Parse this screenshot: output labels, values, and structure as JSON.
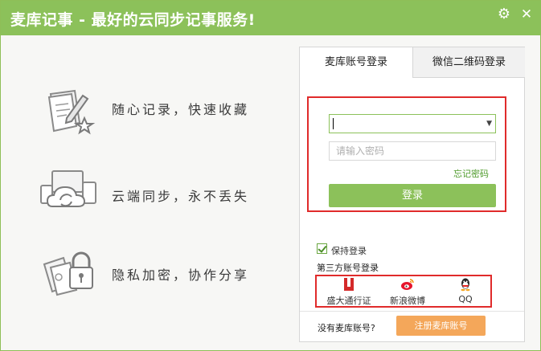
{
  "window": {
    "title": "麦库记事 - 最好的云同步记事服务!"
  },
  "features": [
    {
      "label": "随心记录，快速收藏",
      "icon": "note-pencil-star-icon"
    },
    {
      "label": "云端同步，永不丢失",
      "icon": "cloud-sync-devices-icon"
    },
    {
      "label": "隐私加密，协作分享",
      "icon": "padlock-documents-icon"
    }
  ],
  "tabs": {
    "account": "麦库账号登录",
    "qr": "微信二维码登录",
    "active": "account"
  },
  "login": {
    "account_value": "",
    "password_placeholder": "请输入密码",
    "forgot": "忘记密码",
    "button": "登录"
  },
  "remember": {
    "label": "保持登录",
    "checked": true
  },
  "third_party": {
    "label": "第三方账号登录",
    "providers": [
      {
        "label": "盛大通行证",
        "icon": "shanda-icon"
      },
      {
        "label": "新浪微博",
        "icon": "weibo-icon"
      },
      {
        "label": "QQ",
        "icon": "qq-penguin-icon"
      }
    ]
  },
  "register": {
    "prompt": "没有麦库账号?",
    "button": "注册麦库账号"
  },
  "colors": {
    "brand_green": "#8cc15a",
    "register_orange": "#f4a75a",
    "highlight_red": "#e02b2b"
  }
}
